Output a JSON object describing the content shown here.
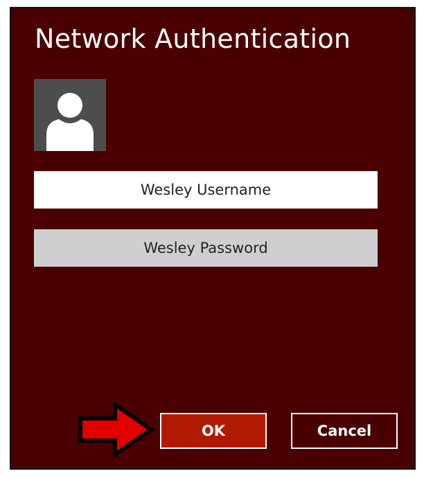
{
  "dialog": {
    "title": "Network Authentication",
    "username": "Wesley Username",
    "password": "Wesley Password",
    "ok_label": "OK",
    "cancel_label": "Cancel"
  },
  "icons": {
    "avatar": "user-avatar-icon",
    "pointer": "red-arrow-icon"
  },
  "colors": {
    "dialog_bg": "#4a0000",
    "ok_bg": "#b01a00",
    "arrow": "#e00000"
  }
}
